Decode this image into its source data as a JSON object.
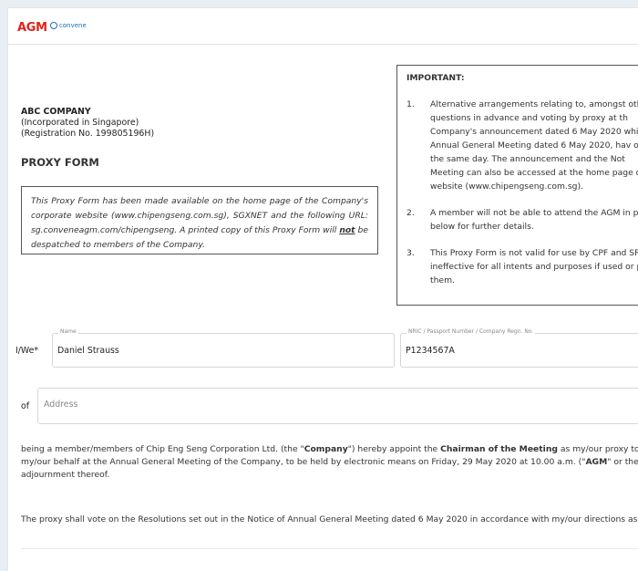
{
  "header": {
    "logo": "AGM",
    "logo_sub": "convene"
  },
  "company": {
    "name": "ABC COMPANY",
    "incorporated": "(Incorporated in Singapore)",
    "registration": "(Registration No. 199805196H)"
  },
  "form_title": "PROXY FORM",
  "notice": {
    "text_before": "This Proxy Form has been made available on the home page of the Company's corporate website (www.chipengseng.com.sg), SGXNET and the following URL: sg.conveneagm.com/chipengseng. A printed copy of this Proxy Form will ",
    "emphasis": "not",
    "text_after": " be despatched to members of the Company."
  },
  "important": {
    "heading": "IMPORTANT:",
    "items": [
      {
        "num": "1.",
        "text": "Alternative arrangements relating to, amongst otl of questions in advance and voting by proxy at th Company's announcement dated 6 May 2020 whi of Annual General Meeting dated 6 May 2020, hav on the same day. The announcement and the Not Meeting can also be accessed at the home page o website (www.chipengseng.com.sg)."
      },
      {
        "num": "2.",
        "text": "A member will not be able to attend the AGM in pe below for further details."
      },
      {
        "num": "3.",
        "text": "This Proxy Form is not valid for use by CPF and SR ineffective for all intents and purposes if used or p them."
      }
    ]
  },
  "form": {
    "iwe_label": "I/We*",
    "name_legend": "Name",
    "name_value": "Daniel Strauss",
    "nric_legend": "NRIC / Passport Number / Company Regn. No.",
    "nric_value": "P1234567A",
    "of_label": "of",
    "address_placeholder": "Address",
    "address_value": ""
  },
  "appoint": {
    "line1_a": "being a member/members of Chip Eng Seng Corporation Ltd. (the \"",
    "line1_company": "Company",
    "line1_b": "\") hereby appoint the ",
    "line1_chairman": "Chairman of the Meeting",
    "line1_c": " as my/our proxy to a",
    "line2_a": "my/our behalf at the Annual General Meeting of the Company, to be held by electronic means on Friday, 29 May 2020 at 10.00 a.m. (\"",
    "line2_agm": "AGM",
    "line2_b": "\" or the \"",
    "line3": "adjournment thereof."
  },
  "proxy_vote_text": "The proxy shall vote on the Resolutions set out in the Notice of Annual General Meeting dated 6 May 2020 in accordance with my/our directions as i"
}
